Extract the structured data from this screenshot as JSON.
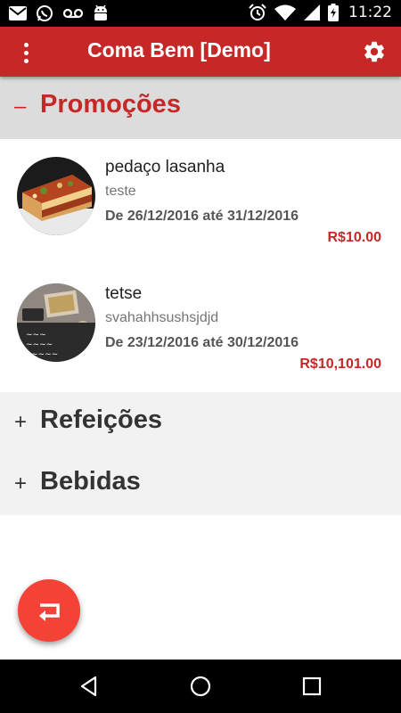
{
  "status_bar": {
    "time": "11:22",
    "left_icons": [
      "email-icon",
      "whatsapp-icon",
      "voicemail-icon",
      "android-icon"
    ],
    "right_icons": [
      "alarm-icon",
      "wifi-icon",
      "signal-icon",
      "battery-icon"
    ]
  },
  "app_bar": {
    "title": "Coma Bem [Demo]",
    "menu_icon": "more-vert-icon",
    "settings_icon": "gear-icon",
    "color": "#c62828"
  },
  "sections": [
    {
      "sign": "–",
      "title": "Promoções",
      "expanded": true,
      "items": [
        {
          "name": "pedaço lasanha",
          "description": "teste",
          "dates": "De 26/12/2016 até 31/12/2016",
          "price": "R$10.00"
        },
        {
          "name": "tetse",
          "description": "svahahhsushsjdjd",
          "dates": "De 23/12/2016 até 30/12/2016",
          "price": "R$10,101.00"
        }
      ]
    },
    {
      "sign": "+",
      "title": "Refeições",
      "expanded": false
    },
    {
      "sign": "+",
      "title": "Bebidas",
      "expanded": false
    }
  ],
  "fab": {
    "icon": "return-icon",
    "color": "#f44336"
  },
  "nav_bar": {
    "icons": [
      "back-icon",
      "home-icon",
      "recents-icon"
    ]
  },
  "colors": {
    "accent": "#c62828",
    "price": "#c62828"
  }
}
